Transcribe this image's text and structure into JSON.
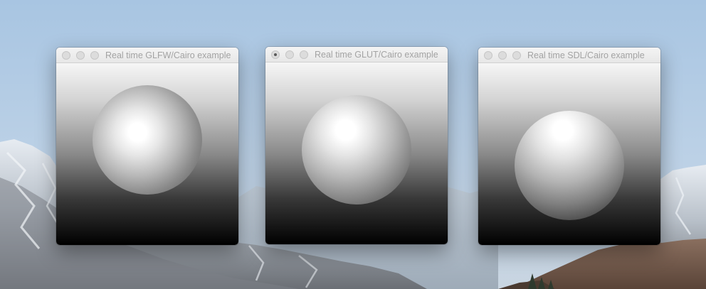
{
  "desktop": {
    "wallpaper": "mountain-landscape",
    "sky_color": "#b5cde5"
  },
  "windows": [
    {
      "title": "Real time GLFW/Cairo example",
      "traffic_lights": [
        "close-button",
        "minimize-button",
        "zoom-button"
      ],
      "document_edited": false
    },
    {
      "title": "Real time GLUT/Cairo example",
      "traffic_lights": [
        "close-button",
        "minimize-button",
        "zoom-button"
      ],
      "document_edited": true
    },
    {
      "title": "Real time SDL/Cairo example",
      "traffic_lights": [
        "close-button",
        "minimize-button",
        "zoom-button"
      ],
      "document_edited": false
    }
  ],
  "colors": {
    "title_text": "#a3a3a3",
    "titlebar_top": "#f4f4f4",
    "titlebar_bottom": "#e7e7e7",
    "traffic_light_inactive": "#dcdcdc",
    "canvas_gradient_top": "#f6f6f6",
    "canvas_gradient_bottom": "#000000"
  }
}
